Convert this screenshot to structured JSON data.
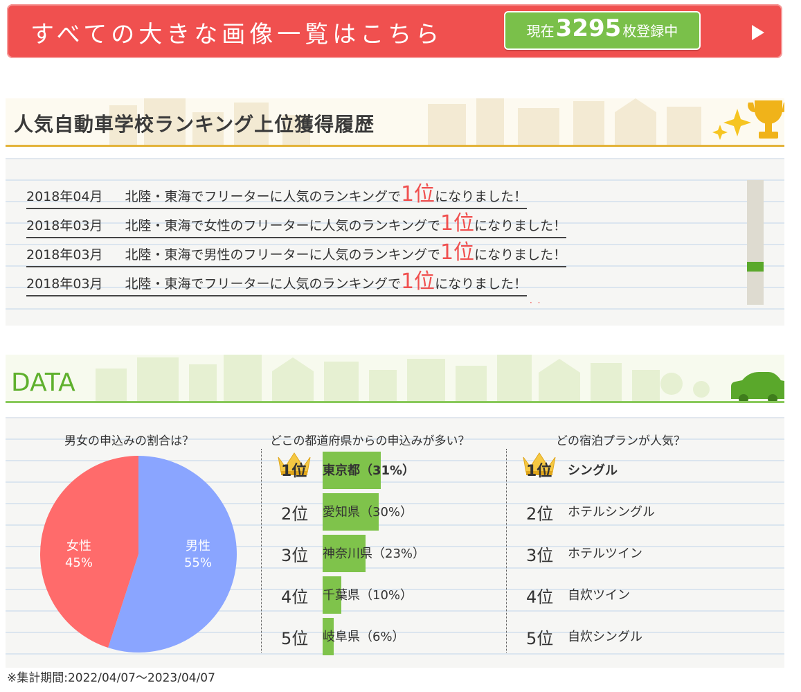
{
  "banner": {
    "text": "すべての大きな画像一覧はこちら",
    "count_prefix": "現在",
    "count": "3295",
    "count_suffix": "枚登録中"
  },
  "ranking": {
    "title": "人気自動車学校ランキング上位獲得履歴",
    "items": [
      {
        "date": "2018年04月",
        "text": "北陸・東海でフリーターに人気のランキングで",
        "rank": "1位",
        "suffix": "になりました！"
      },
      {
        "date": "2018年03月",
        "text": "北陸・東海で女性のフリーターに人気のランキングで",
        "rank": "1位",
        "suffix": "になりました！"
      },
      {
        "date": "2018年03月",
        "text": "北陸・東海で男性のフリーターに人気のランキングで",
        "rank": "1位",
        "suffix": "になりました！"
      },
      {
        "date": "2018年03月",
        "text": "北陸・東海でフリーターに人気のランキングで",
        "rank": "1位",
        "suffix": "になりました！"
      }
    ]
  },
  "data_section": {
    "title": "DATA",
    "gender": {
      "question": "男女の申込みの割合は？",
      "female_label": "女性",
      "female_pct": "45%",
      "male_label": "男性",
      "male_pct": "55%",
      "female_color": "#ff6b6b",
      "male_color": "#8aa5ff"
    },
    "prefecture": {
      "question": "どこの都道府県からの申込みが多い？",
      "items": [
        {
          "rank": "1位",
          "label": "東京都（31%）",
          "pct": 31
        },
        {
          "rank": "2位",
          "label": "愛知県（30%）",
          "pct": 30
        },
        {
          "rank": "3位",
          "label": "神奈川県（23%）",
          "pct": 23
        },
        {
          "rank": "4位",
          "label": "千葉県（10%）",
          "pct": 10
        },
        {
          "rank": "5位",
          "label": "岐阜県（6%）",
          "pct": 6
        }
      ]
    },
    "plan": {
      "question": "どの宿泊プランが人気？",
      "items": [
        {
          "rank": "1位",
          "label": "シングル"
        },
        {
          "rank": "2位",
          "label": "ホテルシングル"
        },
        {
          "rank": "3位",
          "label": "ホテルツイン"
        },
        {
          "rank": "4位",
          "label": "自炊ツイン"
        },
        {
          "rank": "5位",
          "label": "自炊シングル"
        }
      ]
    }
  },
  "footnote": "※集計期間:2022/04/07〜2023/04/07",
  "chart_data": {
    "type": "pie",
    "categories": [
      "女性",
      "男性"
    ],
    "values": [
      45,
      55
    ],
    "title": "男女の申込みの割合は？"
  }
}
